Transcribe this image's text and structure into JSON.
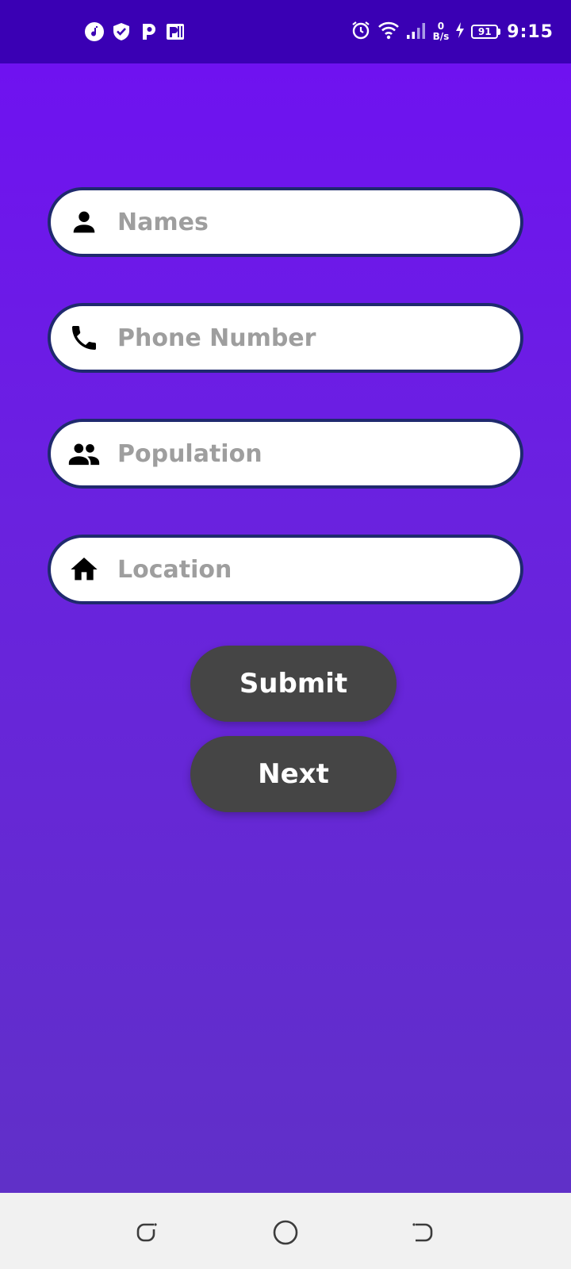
{
  "status_bar": {
    "left_icons": [
      "music-note-icon",
      "shield-check-icon",
      "p-app-icon",
      "parking-app-icon"
    ],
    "net_speed_value": "0",
    "net_speed_unit": "B/s",
    "battery_level": "91",
    "time": "9:15"
  },
  "form": {
    "fields": [
      {
        "icon": "person-icon",
        "placeholder": "Names",
        "value": ""
      },
      {
        "icon": "phone-icon",
        "placeholder": "Phone Number",
        "value": ""
      },
      {
        "icon": "group-icon",
        "placeholder": "Population",
        "value": ""
      },
      {
        "icon": "home-icon",
        "placeholder": "Location",
        "value": ""
      }
    ],
    "submit_label": "Submit",
    "next_label": "Next"
  },
  "colors": {
    "status_bar": "#3a00b4",
    "background_top": "#6f12f0",
    "background_bottom": "#6030c8",
    "field_border": "#1f2a6e",
    "button": "#454545",
    "nav_bar": "#f1f1f1"
  },
  "nav_bar": {
    "icons": [
      "recent-apps-icon",
      "home-circle-icon",
      "back-icon"
    ]
  }
}
